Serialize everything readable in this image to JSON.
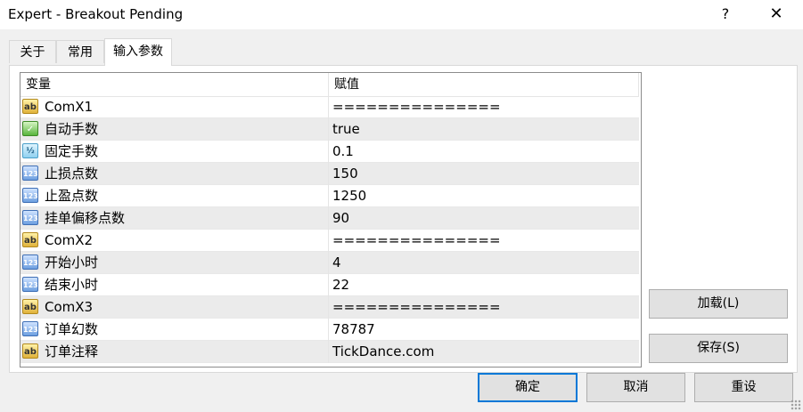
{
  "window": {
    "title": "Expert - Breakout Pending",
    "help_glyph": "?",
    "close_glyph": "✕"
  },
  "tabs": [
    {
      "label": "关于"
    },
    {
      "label": "常用"
    },
    {
      "label": "输入参数",
      "active": true
    }
  ],
  "grid": {
    "headers": {
      "variable": "变量",
      "value": "赋值"
    },
    "rows": [
      {
        "icon": "ab-icon",
        "name": "ComX1",
        "value": "==============="
      },
      {
        "icon": "bool-icon",
        "name": "自动手数",
        "value": "true"
      },
      {
        "icon": "fraction-icon",
        "name": "固定手数",
        "value": "0.1"
      },
      {
        "icon": "number-icon",
        "name": "止损点数",
        "value": "150"
      },
      {
        "icon": "number-icon",
        "name": "止盈点数",
        "value": "1250"
      },
      {
        "icon": "number-icon",
        "name": "挂单偏移点数",
        "value": "90"
      },
      {
        "icon": "ab-icon",
        "name": "ComX2",
        "value": "==============="
      },
      {
        "icon": "number-icon",
        "name": "开始小时",
        "value": "4"
      },
      {
        "icon": "number-icon",
        "name": "结束小时",
        "value": "22"
      },
      {
        "icon": "ab-icon",
        "name": "ComX3",
        "value": "==============="
      },
      {
        "icon": "number-icon",
        "name": "订单幻数",
        "value": "78787"
      },
      {
        "icon": "ab-icon",
        "name": "订单注释",
        "value": "TickDance.com"
      }
    ]
  },
  "icon_glyphs": {
    "ab": "ab",
    "number": "123",
    "fraction": "½",
    "bool": "✓"
  },
  "buttons": {
    "load": "加载(L)",
    "save": "保存(S)",
    "ok": "确定",
    "cancel": "取消",
    "reset": "重设"
  },
  "colors": {
    "focus_border": "#0078d7",
    "alt_row": "#ebebeb",
    "grid_border": "#8c8c8c"
  }
}
